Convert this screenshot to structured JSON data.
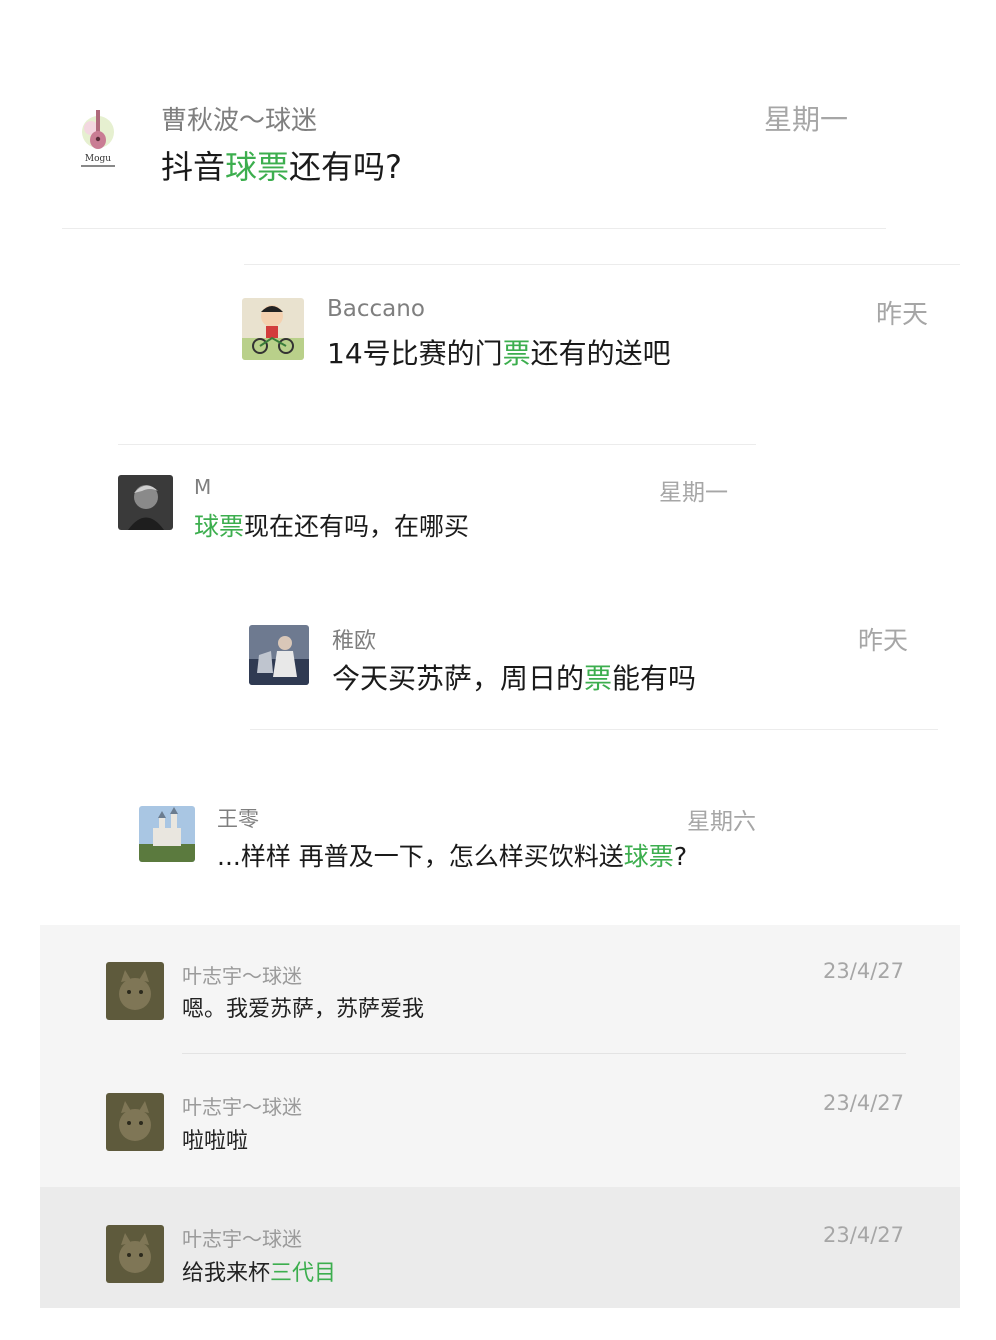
{
  "colors": {
    "highlight": "#3cae4e",
    "name": "#7f7f7f",
    "time": "#a6a6a6",
    "panel_bg": "#f5f5f5",
    "panel_active": "#ebebeb"
  },
  "messages": [
    {
      "name": "曹秋波～球迷",
      "time": "星期一",
      "text_pre": "抖音",
      "text_hl": "球票",
      "text_post": "还有吗?",
      "avatar_icon": "ukulele-logo-avatar",
      "avatar_text": "Mogu"
    },
    {
      "name": "Baccano",
      "time": "昨天",
      "text_pre": "14号比赛的门",
      "text_hl": "票",
      "text_post": "还有的送吧",
      "avatar_icon": "cartoon-boy-bike-avatar"
    },
    {
      "name": "M",
      "time": "星期一",
      "text_pre": "",
      "text_hl": "球票",
      "text_post": "现在还有吗，在哪买",
      "avatar_icon": "dark-portrait-avatar"
    },
    {
      "name": "稚欧",
      "time": "昨天",
      "text_pre": "今天买苏萨，周日的",
      "text_hl": "票",
      "text_post": "能有吗",
      "avatar_icon": "photo-avatar"
    },
    {
      "name": "王零",
      "time": "星期六",
      "text_pre": "...样样 再普及一下，怎么样买饮料送",
      "text_hl": "球票",
      "text_post": "?",
      "avatar_icon": "castle-photo-avatar"
    }
  ],
  "panel_messages": [
    {
      "name": "叶志宇～球迷",
      "time": "23/4/27",
      "text_pre": "嗯。我爱苏萨，苏萨爱我",
      "text_hl": "",
      "text_post": "",
      "avatar_icon": "cat-photo-avatar"
    },
    {
      "name": "叶志宇～球迷",
      "time": "23/4/27",
      "text_pre": "啦啦啦",
      "text_hl": "",
      "text_post": "",
      "avatar_icon": "cat-photo-avatar"
    },
    {
      "name": "叶志宇～球迷",
      "time": "23/4/27",
      "text_pre": "给我来杯",
      "text_hl": "三代目",
      "text_post": "",
      "avatar_icon": "cat-photo-avatar",
      "active": true
    }
  ]
}
